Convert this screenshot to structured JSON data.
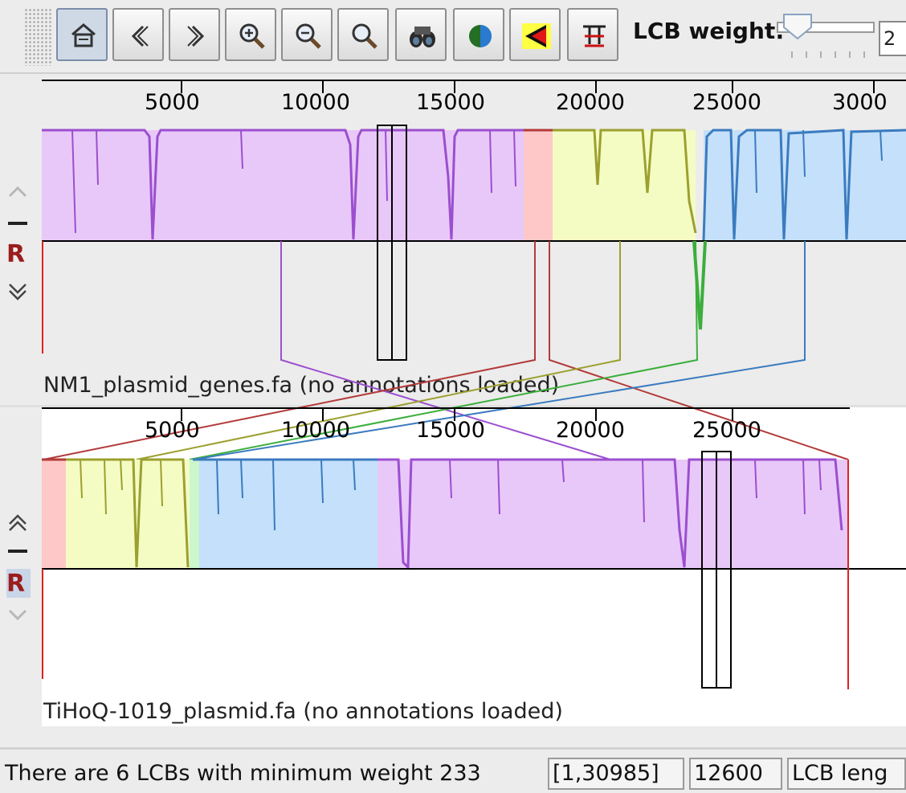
{
  "toolbar": {
    "buttons": [
      "home-icon",
      "back-icon",
      "forward-icon",
      "zoom-in-icon",
      "zoom-out-icon",
      "zoom-icon",
      "binoculars-icon",
      "color-scheme-icon",
      "lcb-direction-icon",
      "hide-lcb-icon"
    ],
    "lcb_weight_label": "LCB weight:",
    "spinner_value": "2"
  },
  "genome1": {
    "ruler_ticks": [
      "5000",
      "10000",
      "15000",
      "20000",
      "25000",
      "3000"
    ],
    "name_label": "NM1_plasmid_genes.fa (no annotations loaded)"
  },
  "genome2": {
    "ruler_ticks": [
      "5000",
      "10000",
      "15000",
      "20000",
      "25000"
    ],
    "name_label": "TiHoQ-1019_plasmid.fa (no annotations loaded)"
  },
  "side_controls": {
    "reference_marker": "R"
  },
  "status": {
    "message": "There are 6 LCBs with minimum weight 233",
    "range": "[1,30985]",
    "position": "12600",
    "lcb_length_label": "LCB leng"
  },
  "colors": {
    "purple": "#9b4fcf",
    "purple_fill": "#e8c8f8",
    "red": "#b33a3a",
    "red_fill": "#ffc8c8",
    "olive": "#9ca02f",
    "olive_fill": "#f4fcc4",
    "blue": "#3b7bbf",
    "blue_fill": "#c4e0fa",
    "green": "#3cae3c",
    "accent_red": "#9b1c1c"
  }
}
